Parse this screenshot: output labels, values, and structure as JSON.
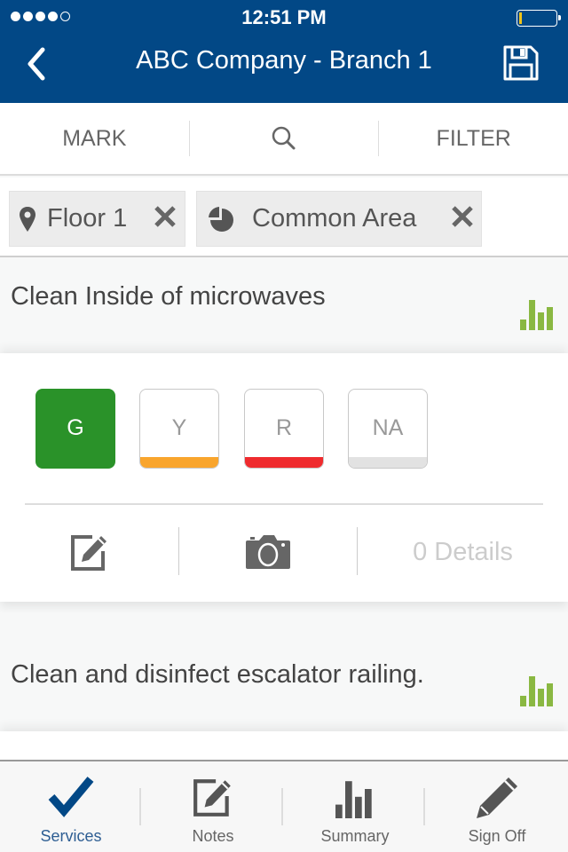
{
  "status_bar": {
    "signal_bars_filled": 4,
    "signal_bars_total": 5,
    "time": "12:51 PM",
    "battery_level_percent": 5
  },
  "header": {
    "title": "ABC Company - Branch 1",
    "back_icon": "chevron-left-icon",
    "save_icon": "floppy-disk-icon",
    "background_color": "#024886"
  },
  "toolbar": {
    "mark_label": "MARK",
    "search_icon": "search-icon",
    "filter_label": "FILTER"
  },
  "filters": [
    {
      "icon": "map-pin-icon",
      "label": "Floor 1",
      "remove_icon": "close-icon"
    },
    {
      "icon": "pie-chart-icon",
      "label": "Common Area",
      "remove_icon": "close-icon"
    }
  ],
  "tasks": [
    {
      "title": "Clean Inside of microwaves",
      "stats_icon": "bar-chart-icon",
      "expanded": true,
      "ratings": [
        {
          "label": "G",
          "color": "#2a9229",
          "selected": true
        },
        {
          "label": "Y",
          "color": "#f9a52d",
          "selected": false
        },
        {
          "label": "R",
          "color": "#ef2b2e",
          "selected": false
        },
        {
          "label": "NA",
          "color": "#e2e2e2",
          "selected": false
        }
      ],
      "actions": {
        "note_icon": "edit-note-icon",
        "camera_icon": "camera-icon",
        "details_label": "0 Details"
      }
    },
    {
      "title": "Clean and disinfect escalator railing.",
      "stats_icon": "bar-chart-icon",
      "expanded": false
    }
  ],
  "accent_green": "#8ab842",
  "tabbar": {
    "tabs": [
      {
        "label": "Services",
        "icon": "checkmark-icon",
        "active": true
      },
      {
        "label": "Notes",
        "icon": "edit-note-icon",
        "active": false
      },
      {
        "label": "Summary",
        "icon": "bar-chart-icon",
        "active": false
      },
      {
        "label": "Sign Off",
        "icon": "pencil-icon",
        "active": false
      }
    ]
  }
}
